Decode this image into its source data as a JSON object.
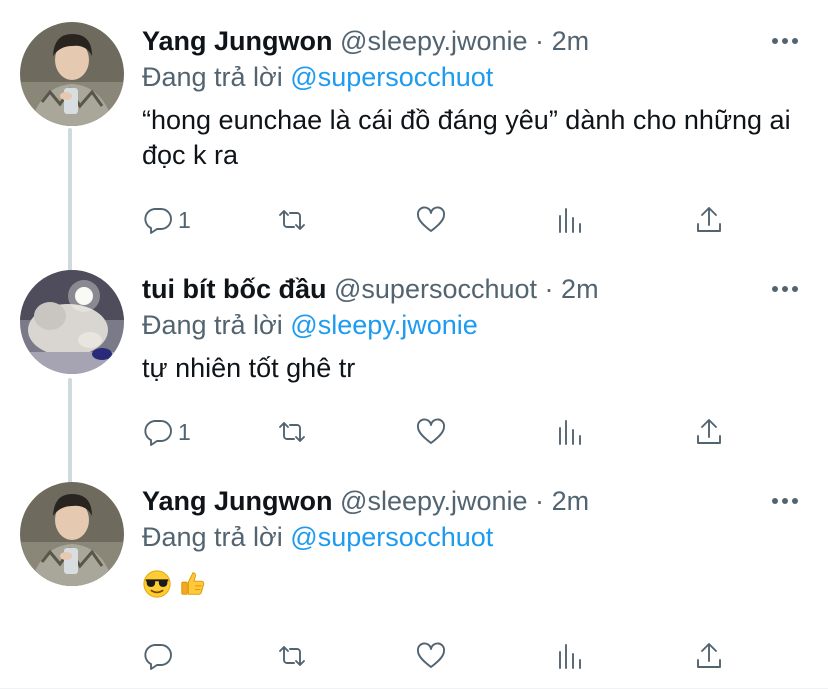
{
  "tweets": [
    {
      "display_name": "Yang Jungwon",
      "handle": "@sleepy.jwonie",
      "separator": "·",
      "time": "2m",
      "replying_prefix": "Đang trả lời",
      "replying_to": "@supersocchuot",
      "text": "“hong eunchae là cái đồ đáng yêu” dành cho những ai đọc k ra",
      "reply_count": "1"
    },
    {
      "display_name": "tui bít bốc đầu",
      "handle": "@supersocchuot",
      "separator": "·",
      "time": "2m",
      "replying_prefix": "Đang trả lời",
      "replying_to": "@sleepy.jwonie",
      "text": "tự nhiên tốt ghê tr",
      "reply_count": "1"
    },
    {
      "display_name": "Yang Jungwon",
      "handle": "@sleepy.jwonie",
      "separator": "·",
      "time": "2m",
      "replying_prefix": "Đang trả lời",
      "replying_to": "@supersocchuot",
      "emojis": [
        "smiling-face-with-sunglasses",
        "thumbs-up"
      ]
    }
  ],
  "colors": {
    "link": "#1d9bf0",
    "secondary_text": "#536471",
    "primary_text": "#0f1419",
    "thread_line": "#cfd9de"
  },
  "icons": [
    "comment-icon",
    "retweet-icon",
    "heart-icon",
    "stats-icon",
    "share-icon",
    "more-icon"
  ]
}
